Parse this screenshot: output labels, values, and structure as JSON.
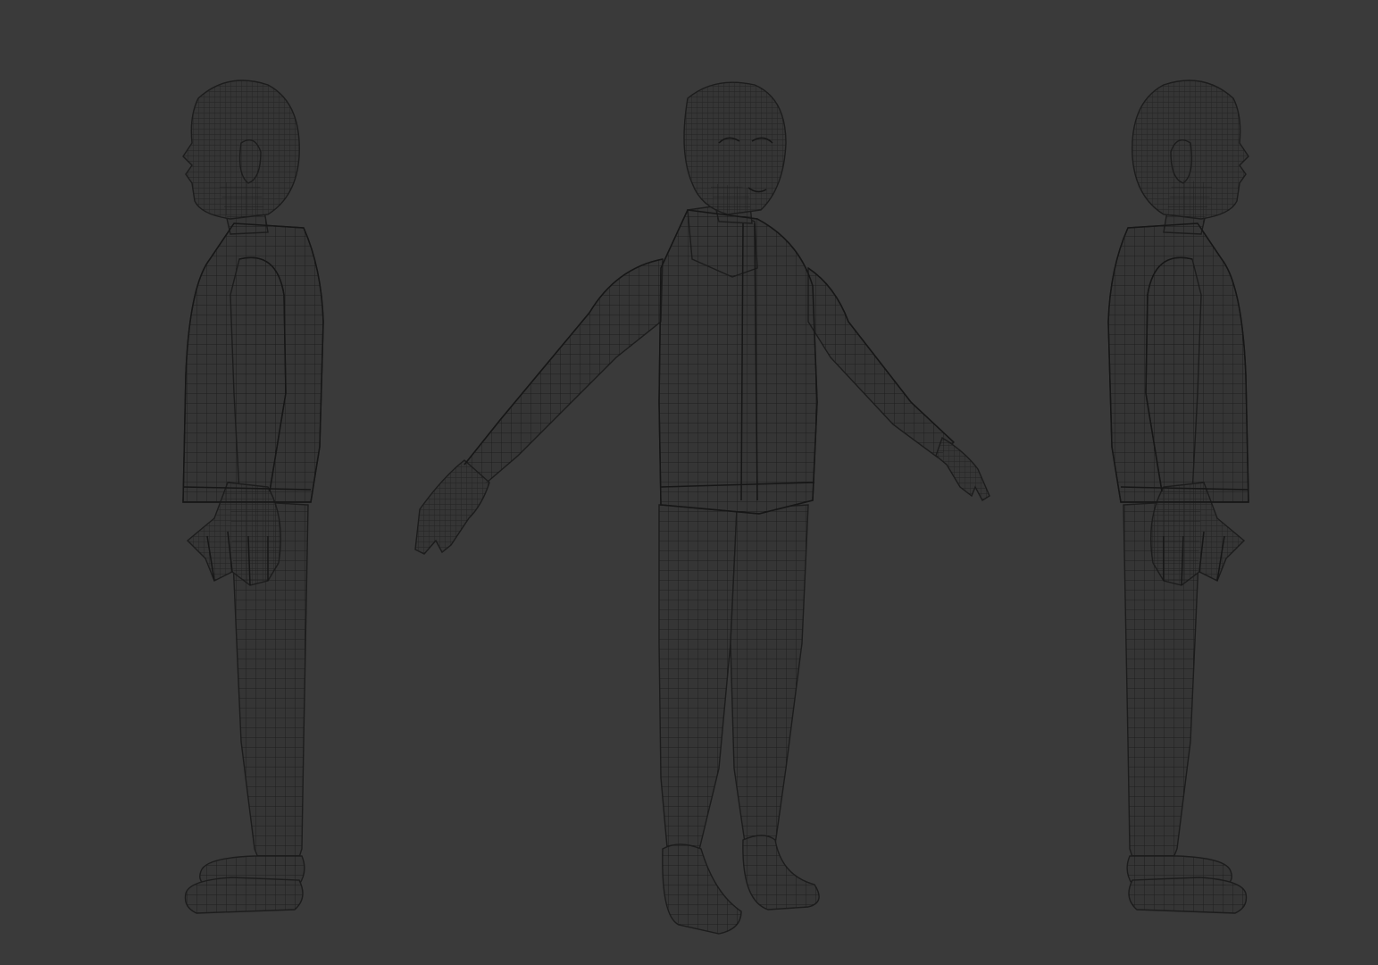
{
  "viewport": {
    "background_color": "#3a3a3a",
    "mesh_fill_color": "#353535",
    "wire_color": "#1a1a1a",
    "views": [
      {
        "name": "side-view-left",
        "facing": "left"
      },
      {
        "name": "front-view-three-quarter",
        "facing": "front"
      },
      {
        "name": "side-view-right",
        "facing": "right"
      }
    ]
  }
}
